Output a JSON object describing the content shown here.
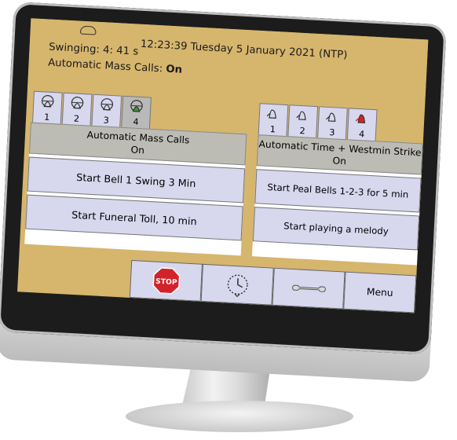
{
  "header": {
    "clock": "12:23:39 Tuesday 5 January 2021  (NTP)",
    "swinging": "Swinging:  4: 41 s",
    "mass_calls_prefix": "Automatic Mass Calls: ",
    "mass_calls_state": "On"
  },
  "left_tabs": [
    {
      "number": "1",
      "icon": "bell-wheel-icon"
    },
    {
      "number": "2",
      "icon": "bell-wheel-icon"
    },
    {
      "number": "3",
      "icon": "bell-wheel-icon"
    },
    {
      "number": "4",
      "icon": "bell-wheel-icon",
      "active": true
    }
  ],
  "right_tabs": [
    {
      "number": "1",
      "icon": "bell-hammer-icon"
    },
    {
      "number": "2",
      "icon": "bell-hammer-icon"
    },
    {
      "number": "3",
      "icon": "bell-hammer-icon"
    },
    {
      "number": "4",
      "icon": "bell-hammer-icon",
      "alert": true
    }
  ],
  "left_panel": {
    "title": "Automatic Mass Calls",
    "state": "On",
    "buttons": [
      "Start Bell 1 Swing 3 Min",
      "Start Funeral Toll, 10 min"
    ]
  },
  "right_panel": {
    "title": "Automatic Time + Westmin Strike",
    "state": "On",
    "buttons": [
      "Start Peal Bells 1-2-3 for 5 min",
      "Start playing a melody"
    ]
  },
  "toolbar": {
    "stop_label": "STOP",
    "menu_label": "Menu"
  },
  "colors": {
    "header_bg": "#d6b56d",
    "button_bg": "#d7d7ee",
    "panel_head_bg": "#bcbcb4",
    "stop_red": "#d2232a",
    "active_bell_green": "#3a9a3a",
    "alert_bell_red": "#d2232a"
  }
}
